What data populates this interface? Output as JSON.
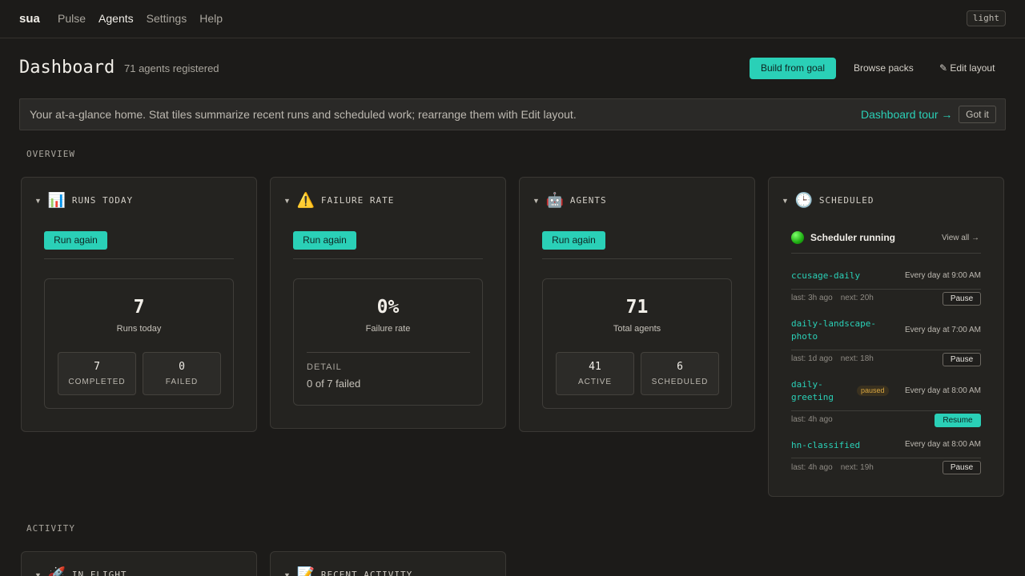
{
  "nav": {
    "brand": "sua",
    "links": [
      "Pulse",
      "Agents",
      "Settings",
      "Help"
    ],
    "active": "Agents",
    "theme_toggle": "light"
  },
  "header": {
    "title": "Dashboard",
    "subtitle": "71 agents registered",
    "build_button": "Build from goal",
    "browse_button": "Browse packs",
    "edit_button": "✎ Edit layout"
  },
  "banner": {
    "text": "Your at-a-glance home. Stat tiles summarize recent runs and scheduled work; rearrange them with Edit layout.",
    "tour_link": "Dashboard tour →",
    "dismiss": "Got it"
  },
  "sections": {
    "overview": "OVERVIEW",
    "activity": "ACTIVITY"
  },
  "cards": {
    "runs": {
      "caret": "▼",
      "icon": "📊",
      "title": "RUNS TODAY",
      "run_again": "Run again",
      "value": "7",
      "label": "Runs today",
      "completed_value": "7",
      "completed_label": "COMPLETED",
      "failed_value": "0",
      "failed_label": "FAILED"
    },
    "failure": {
      "caret": "▼",
      "icon": "⚠️",
      "title": "FAILURE RATE",
      "run_again": "Run again",
      "value": "0%",
      "label": "Failure rate",
      "detail_label": "DETAIL",
      "detail_value": "0 of 7 failed"
    },
    "agents": {
      "caret": "▼",
      "icon": "🤖",
      "title": "AGENTS",
      "run_again": "Run again",
      "value": "71",
      "label": "Total agents",
      "active_value": "41",
      "active_label": "ACTIVE",
      "scheduled_value": "6",
      "scheduled_label": "SCHEDULED"
    },
    "scheduled": {
      "caret": "▼",
      "icon": "🕒",
      "title": "SCHEDULED",
      "status": "Scheduler running",
      "view_all": "View all →",
      "jobs": [
        {
          "name": "ccusage-daily",
          "schedule": "Every day at 9:00 AM",
          "last": "last: 3h ago",
          "next": "next: 20h",
          "action": "Pause"
        },
        {
          "name": "daily-landscape-photo",
          "name_l1": "daily-landscape-",
          "name_l2": "photo",
          "schedule": "Every day at 7:00 AM",
          "last": "last: 1d ago",
          "next": "next: 18h",
          "action": "Pause"
        },
        {
          "name": "daily-greeting",
          "name_l1": "daily-",
          "name_l2": "greeting",
          "badge": "paused",
          "schedule": "Every day at 8:00 AM",
          "last": "last: 4h ago",
          "action": "Resume"
        },
        {
          "name": "hn-classified",
          "schedule": "Every day at 8:00 AM",
          "last": "last: 4h ago",
          "next": "next: 19h",
          "action": "Pause"
        }
      ]
    },
    "inflight": {
      "caret": "▼",
      "icon": "🚀",
      "title": "IN FLIGHT"
    },
    "recent": {
      "caret": "▼",
      "icon": "📝",
      "title": "RECENT ACTIVITY"
    }
  }
}
